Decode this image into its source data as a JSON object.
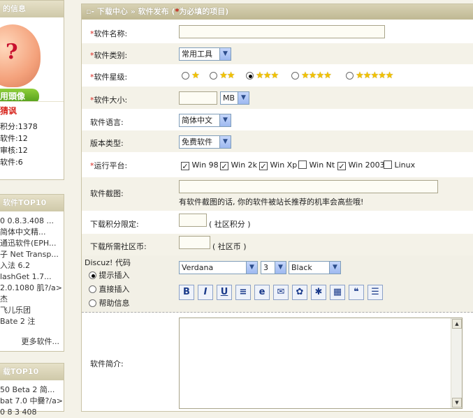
{
  "sidebar": {
    "user_box": {
      "title": "的信息",
      "avatar_label": "用頭像",
      "username": "猜讽",
      "stats": [
        "积分:1378",
        "软件:12",
        "审核:12",
        "软件:6"
      ]
    },
    "top_box": {
      "title": "软件TOP10",
      "items": [
        "0 0.8.3.408 ...",
        "简体中文精...",
        "通迅软件(EPH...",
        "子 Net Transp...",
        "入法 6.2",
        "lashGet 1.7...",
        "2.0.1080 肌?/a>",
        "杰",
        "飞儿乐团",
        "Bate 2 注"
      ],
      "more": "更多软件..."
    },
    "dl_box": {
      "title": "载TOP10",
      "items": [
        "50 Beta 2 简...",
        "bat 7.0 中爨?/a>",
        "0 8 3 408"
      ]
    }
  },
  "main": {
    "header": {
      "section": "下载中心",
      "sep": "»",
      "page": "软件发布",
      "note_open": "(",
      "note_star": "*",
      "note_text": "为必填的项目)"
    },
    "form": {
      "name_label": "软件名称:",
      "category_label": "软件类别:",
      "category_value": "常用工具",
      "rating_label": "软件星级:",
      "rating_options": [
        1,
        2,
        3,
        4,
        5
      ],
      "rating_selected": 3,
      "size_label": "软件大小:",
      "size_unit": "MB",
      "language_label": "软件语言:",
      "language_value": "简体中文",
      "version_label": "版本类型:",
      "version_value": "免费软件",
      "platform_label": "运行平台:",
      "platforms": [
        {
          "name": "Win 98",
          "checked": true
        },
        {
          "name": "Win 2k",
          "checked": true
        },
        {
          "name": "Win Xp",
          "checked": true
        },
        {
          "name": "Win Nt",
          "checked": false
        },
        {
          "name": "Win 2003",
          "checked": true
        },
        {
          "name": "Linux",
          "checked": false
        }
      ],
      "screenshot_label": "软件截图:",
      "screenshot_hint": "有软件截图的话, 你的软件被站长推荐的机率会高些哦!",
      "points_label": "下载积分限定:",
      "points_hint": "( 社区积分 )",
      "coins_label": "下载所需社区币:",
      "coins_hint": "( 社区币 )",
      "editor": {
        "title": "Discuz! 代码",
        "modes": [
          "提示插入",
          "直接插入",
          "帮助信息"
        ],
        "mode_selected": 0,
        "font": "Verdana",
        "size": "3",
        "color": "Black",
        "tools": [
          {
            "name": "bold-icon",
            "glyph": "B"
          },
          {
            "name": "italic-icon",
            "glyph": "I"
          },
          {
            "name": "underline-icon",
            "glyph": "U"
          },
          {
            "name": "align-icon",
            "glyph": "≡"
          },
          {
            "name": "link-icon",
            "glyph": "e"
          },
          {
            "name": "email-icon",
            "glyph": "✉"
          },
          {
            "name": "image-icon",
            "glyph": "✿"
          },
          {
            "name": "flash-icon",
            "glyph": "✱"
          },
          {
            "name": "code-icon",
            "glyph": "▦"
          },
          {
            "name": "quote-icon",
            "glyph": "❝"
          },
          {
            "name": "list-icon",
            "glyph": "☰"
          }
        ]
      },
      "intro_label": "软件简介:"
    }
  }
}
